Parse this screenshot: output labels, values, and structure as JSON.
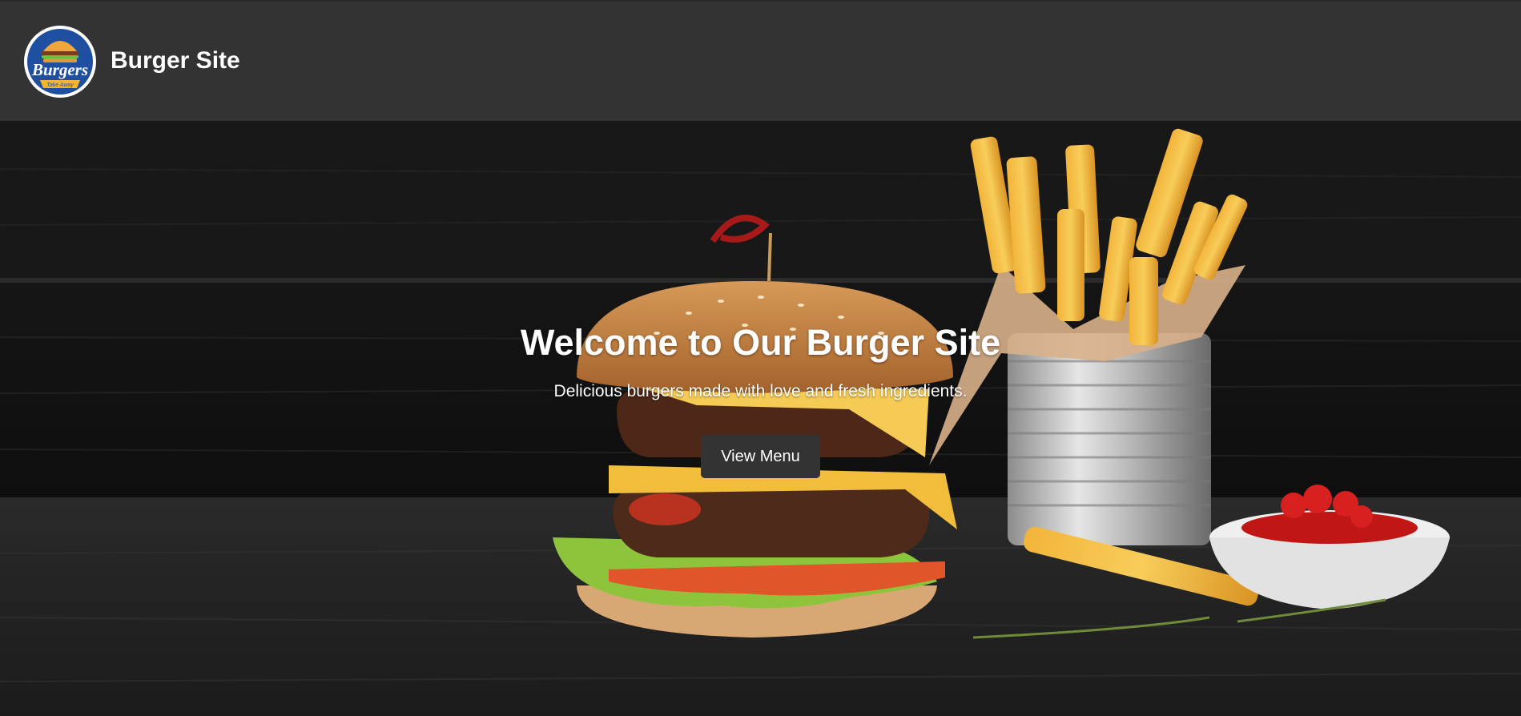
{
  "header": {
    "logo": {
      "icon": "burger-logo-icon",
      "text": "Burgers",
      "tagline": "Take Away"
    },
    "title": "Burger Site"
  },
  "hero": {
    "heading": "Welcome to Our Burger Site",
    "subheading": "Delicious burgers made with love and fresh ingredients.",
    "cta_label": "View Menu",
    "image_subject": "burger, fries and ketchup on dark wooden table"
  },
  "colors": {
    "header_bg": "#333333",
    "button_bg": "#333333",
    "text": "#ffffff",
    "logo_blue": "#1f4fa0",
    "logo_yellow": "#f2b630"
  }
}
